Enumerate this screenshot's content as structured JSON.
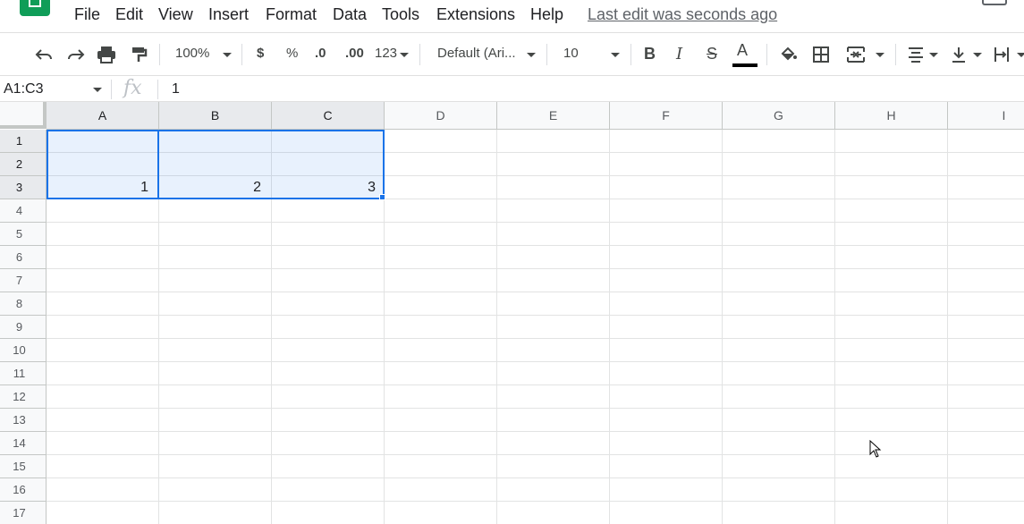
{
  "menubar": {
    "items": [
      "File",
      "Edit",
      "View",
      "Insert",
      "Format",
      "Data",
      "Tools",
      "Extensions",
      "Help"
    ],
    "last_edit": "Last edit was seconds ago"
  },
  "toolbar": {
    "zoom": "100%",
    "currency": "$",
    "percent": "%",
    "decrease_decimal": ".0",
    "increase_decimal": ".00",
    "more_formats": "123",
    "font": "Default (Ari...",
    "font_size": "10",
    "bold": "B",
    "italic": "I",
    "strikethrough": "S",
    "text_color_label": "A"
  },
  "formula_bar": {
    "name_box": "A1:C3",
    "fx": "fx",
    "value": "1"
  },
  "sheet": {
    "columns": [
      "A",
      "B",
      "C",
      "D",
      "E",
      "F",
      "G",
      "H",
      "I"
    ],
    "rows": [
      "1",
      "2",
      "3",
      "4",
      "5",
      "6",
      "7",
      "8",
      "9",
      "10",
      "11",
      "12",
      "13",
      "14",
      "15",
      "16",
      "17"
    ],
    "selected_range": "A1:C3",
    "cells": {
      "A3": "1",
      "B3": "2",
      "C3": "3"
    }
  },
  "colors": {
    "accent": "#1a73e8",
    "logo": "#0f9d58"
  }
}
